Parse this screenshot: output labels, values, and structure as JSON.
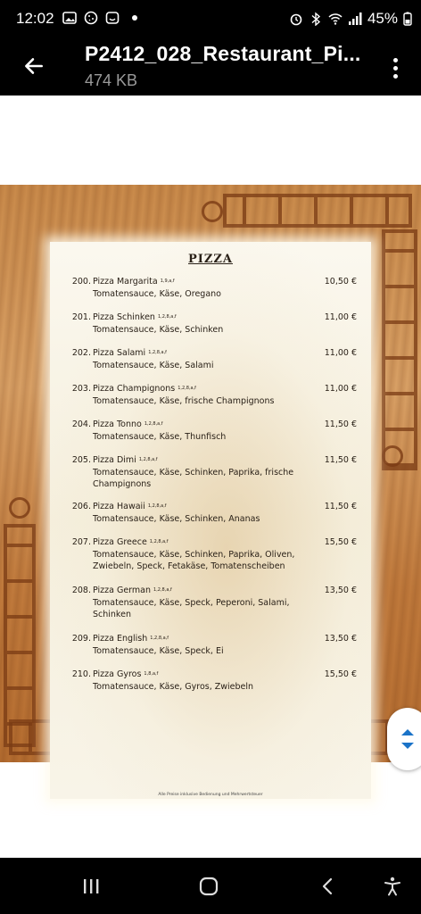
{
  "status_bar": {
    "time": "12:02",
    "battery": "45%"
  },
  "app_bar": {
    "title": "P2412_028_Restaurant_Pi...",
    "subtitle": "474 KB"
  },
  "menu": {
    "title": "PIZZA",
    "currency": "€",
    "items": [
      {
        "num": "200.",
        "name": "Pizza Margarita",
        "allergens": "1,9,a,f",
        "desc": "Tomatensauce, Käse, Oregano",
        "price": "10,50 €"
      },
      {
        "num": "201.",
        "name": "Pizza Schinken",
        "allergens": "1,2,8,a,f",
        "desc": "Tomatensauce, Käse, Schinken",
        "price": "11,00 €"
      },
      {
        "num": "202.",
        "name": "Pizza Salami",
        "allergens": "1,2,8,a,f",
        "desc": "Tomatensauce, Käse, Salami",
        "price": "11,00 €"
      },
      {
        "num": "203.",
        "name": "Pizza Champignons",
        "allergens": "1,2,8,a,f",
        "desc": "Tomatensauce, Käse, frische Champignons",
        "price": "11,00 €"
      },
      {
        "num": "204.",
        "name": "Pizza Tonno",
        "allergens": "1,2,8,a,f",
        "desc": "Tomatensauce, Käse, Thunfisch",
        "price": "11,50 €"
      },
      {
        "num": "205.",
        "name": "Pizza Dimi",
        "allergens": "1,2,8,a,f",
        "desc": "Tomatensauce, Käse, Schinken, Paprika, frische Champignons",
        "price": "11,50 €"
      },
      {
        "num": "206.",
        "name": "Pizza Hawaii",
        "allergens": "1,2,8,a,f",
        "desc": "Tomatensauce, Käse, Schinken, Ananas",
        "price": "11,50 €"
      },
      {
        "num": "207.",
        "name": "Pizza Greece",
        "allergens": "1,2,8,a,f",
        "desc": "Tomatensauce, Käse, Schinken, Paprika, Oliven, Zwiebeln, Speck, Fetakäse, Tomatenscheiben",
        "price": "15,50 €"
      },
      {
        "num": "208.",
        "name": "Pizza German",
        "allergens": "1,2,8,a,f",
        "desc": "Tomatensauce, Käse, Speck, Peperoni, Salami, Schinken",
        "price": "13,50 €"
      },
      {
        "num": "209.",
        "name": "Pizza English",
        "allergens": "1,2,8,a,f",
        "desc": "Tomatensauce, Käse, Speck, Ei",
        "price": "13,50 €"
      },
      {
        "num": "210.",
        "name": "Pizza Gyros",
        "allergens": "1,8,a,f",
        "desc": "Tomatensauce, Käse, Gyros, Zwiebeln",
        "price": "15,50 €"
      }
    ],
    "footnote": "Alle Preise inklusive Bedienung und Mehrwertsteuer"
  },
  "icons": {
    "back": "arrow-left-icon",
    "more": "more-vert-icon",
    "scroll": "scroll-updown-icon"
  },
  "colors": {
    "bar_background": "#000000",
    "scroll_arrow": "#1a73c8"
  }
}
